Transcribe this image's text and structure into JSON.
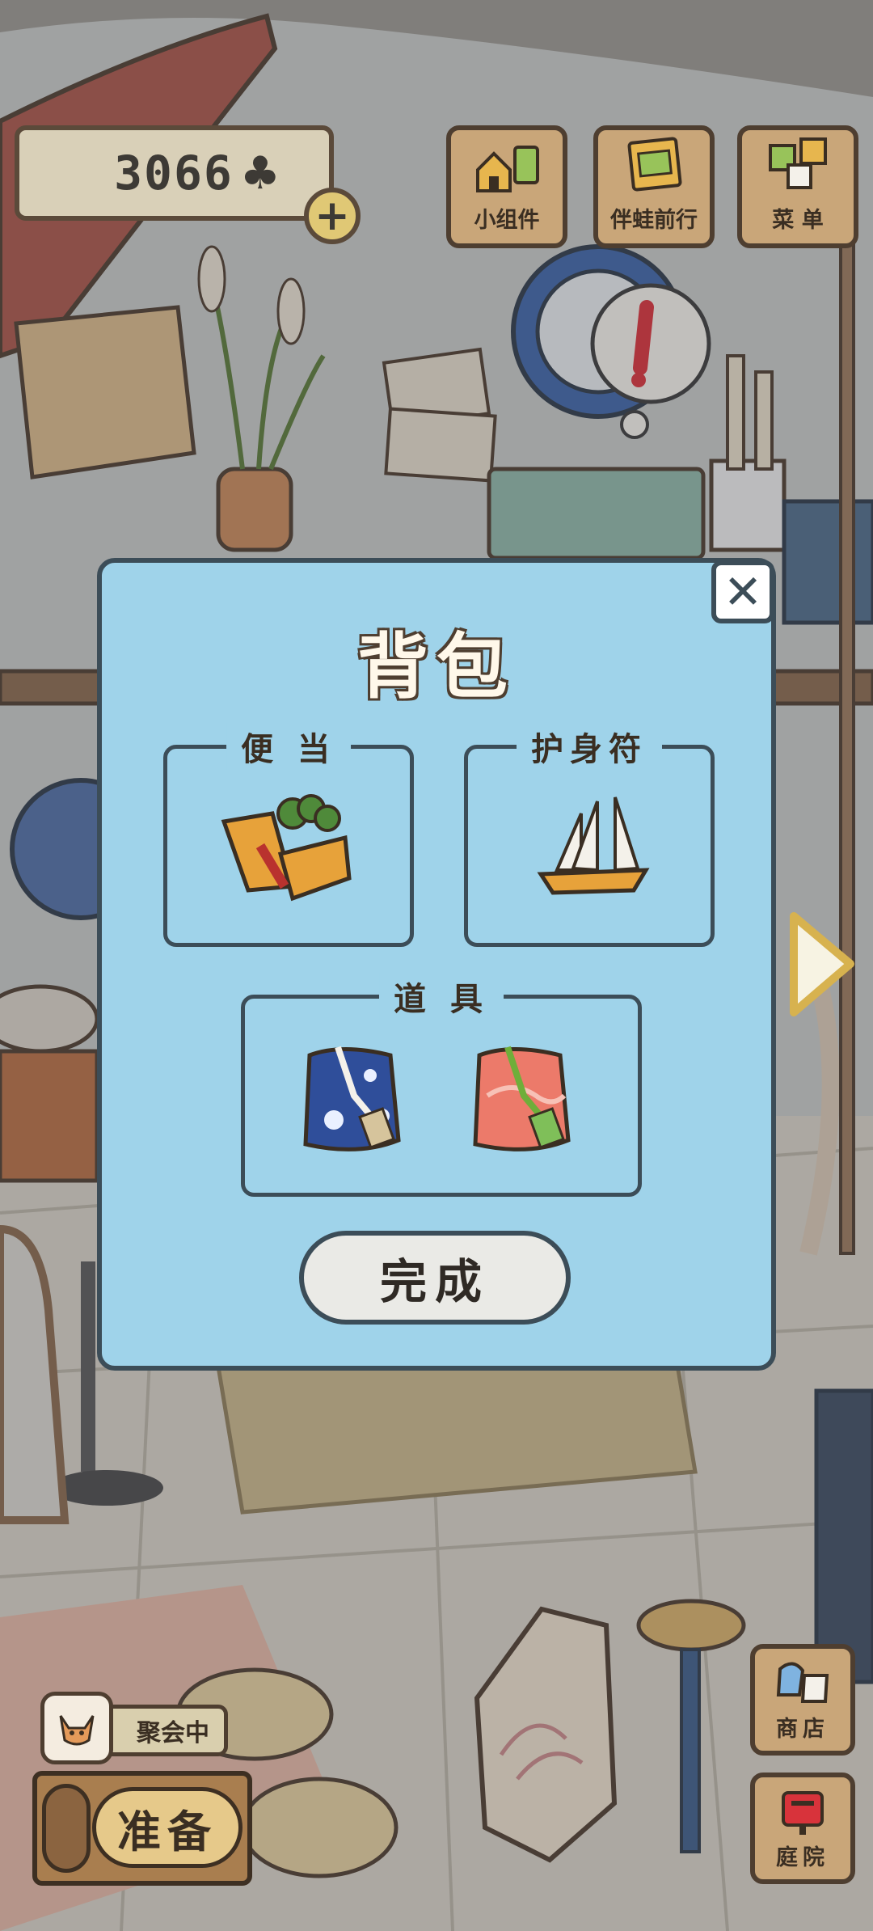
{
  "hud": {
    "clover_count": "3066",
    "clover_icon": "♣",
    "plus_symbol": "+",
    "buttons": [
      {
        "label": "小组件",
        "icon": "widget-icon"
      },
      {
        "label": "伴蛙前行",
        "icon": "journey-icon"
      },
      {
        "label": "菜 单",
        "icon": "menu-icon"
      }
    ]
  },
  "modal": {
    "title": "背包",
    "close_symbol": "✕",
    "slots": {
      "bento": {
        "label": "便 当",
        "icon": "sandwich-icon"
      },
      "charm": {
        "label": "护身符",
        "icon": "sailboat-charm-icon"
      },
      "tools": {
        "label": "道 具",
        "items": [
          {
            "icon": "blue-furoshiki-icon"
          },
          {
            "icon": "red-furoshiki-icon"
          }
        ]
      }
    },
    "done_label": "完成"
  },
  "bottom": {
    "party_status": "聚会中",
    "prepare_label": "准备",
    "shop_label": "商店",
    "garden_label": "庭院"
  },
  "colors": {
    "modal_bg": "#9fd3ea",
    "modal_border": "#3c4d58",
    "wood": "#c9a679"
  }
}
